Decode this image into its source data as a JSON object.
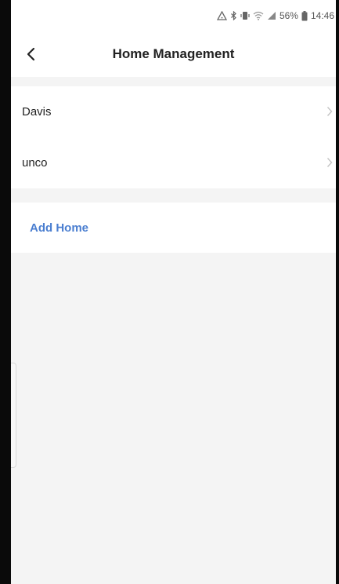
{
  "status_bar": {
    "battery_percent": "56%",
    "time": "14:46",
    "icons": [
      "alert-icon",
      "bluetooth-icon",
      "vibrate-icon",
      "wifi-icon",
      "signal-icon",
      "battery-icon"
    ]
  },
  "header": {
    "title": "Home Management",
    "back_icon": "chevron-left-icon"
  },
  "homes": [
    {
      "name": "Davis"
    },
    {
      "name": "unco"
    }
  ],
  "actions": {
    "add_home_label": "Add Home"
  },
  "colors": {
    "accent": "#4a7ed0",
    "background": "#f4f4f4",
    "surface": "#ffffff",
    "text": "#222222"
  }
}
